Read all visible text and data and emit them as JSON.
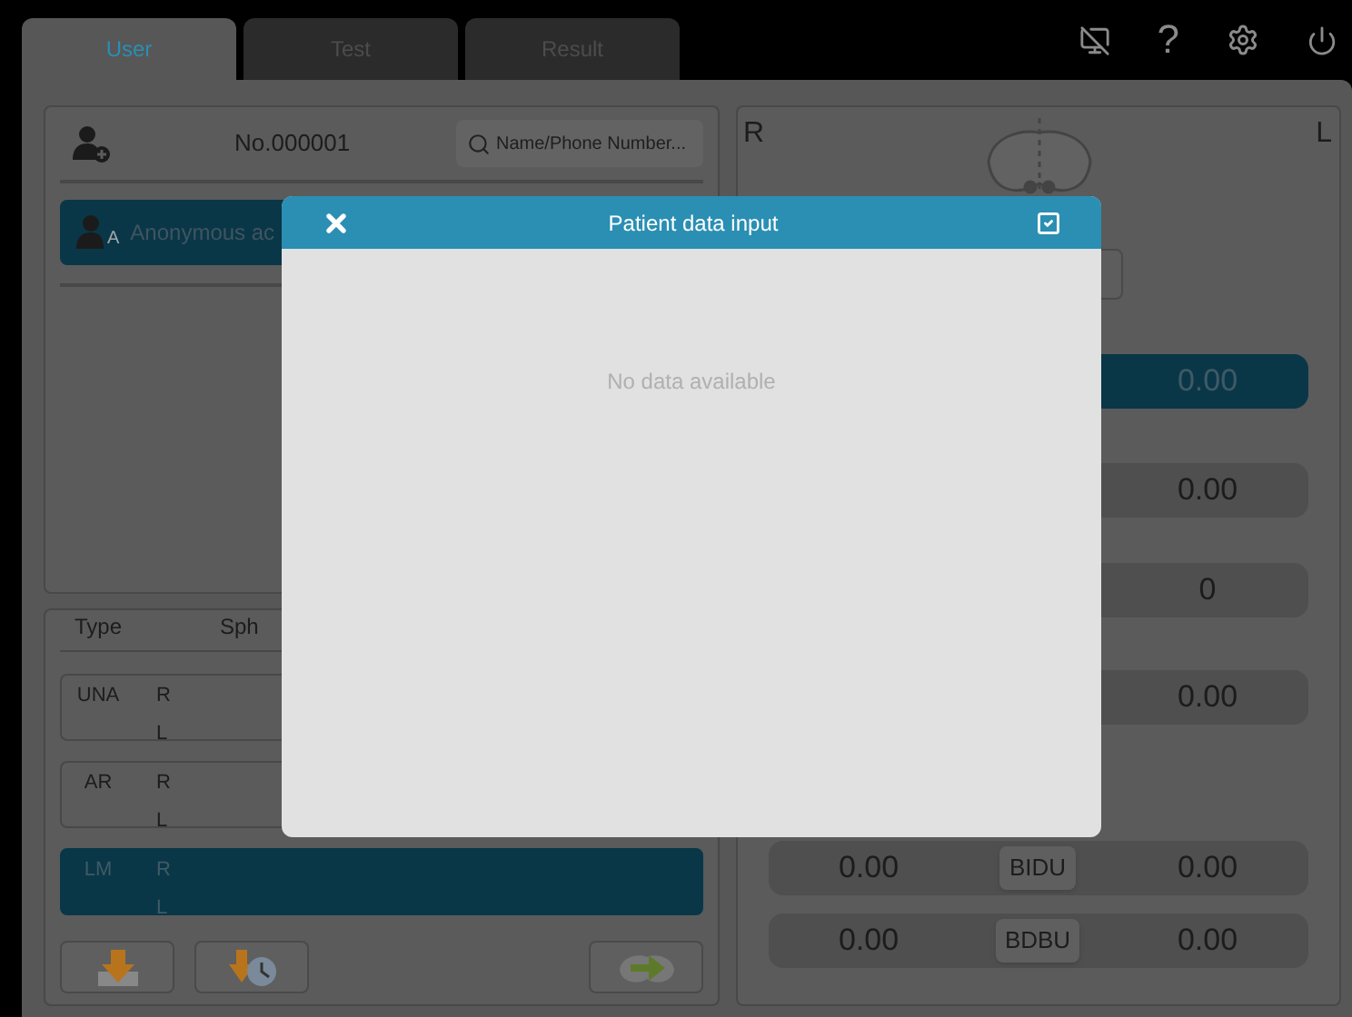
{
  "tabs": [
    {
      "label": "User",
      "selected": true
    },
    {
      "label": "Test",
      "selected": false
    },
    {
      "label": "Result",
      "selected": false
    }
  ],
  "toolbar": {
    "help_glyph": "?"
  },
  "patient": {
    "number": "No.000001",
    "search": {
      "placeholder": "Name/Phone Number..."
    }
  },
  "patients": [
    {
      "badge": "A",
      "name": "Anonymous ac",
      "selected": true
    }
  ],
  "refraction_table": {
    "columns": [
      "Type",
      "Sph"
    ],
    "rows": [
      {
        "type": "UNA",
        "eyes": [
          "R",
          "L"
        ],
        "selected": false
      },
      {
        "type": "AR",
        "eyes": [
          "R",
          "L"
        ],
        "selected": false
      },
      {
        "type": "LM",
        "eyes": [
          "R",
          "L"
        ],
        "selected": true
      }
    ]
  },
  "eye_panel": {
    "right_label": "R",
    "left_label": "L",
    "rows": [
      {
        "right_value": "0.00",
        "selected": true
      },
      {
        "right_value": "0.00",
        "selected": false
      },
      {
        "right_value": "0",
        "selected": false
      },
      {
        "right_value": "0.00",
        "selected": false
      },
      {
        "left_value": "0.00",
        "button": "BIDU",
        "right_value": "0.00",
        "selected": false
      },
      {
        "left_value": "0.00",
        "button": "BDBU",
        "right_value": "0.00",
        "selected": false
      }
    ]
  },
  "dialog": {
    "title": "Patient data input",
    "empty_message": "No data available"
  }
}
